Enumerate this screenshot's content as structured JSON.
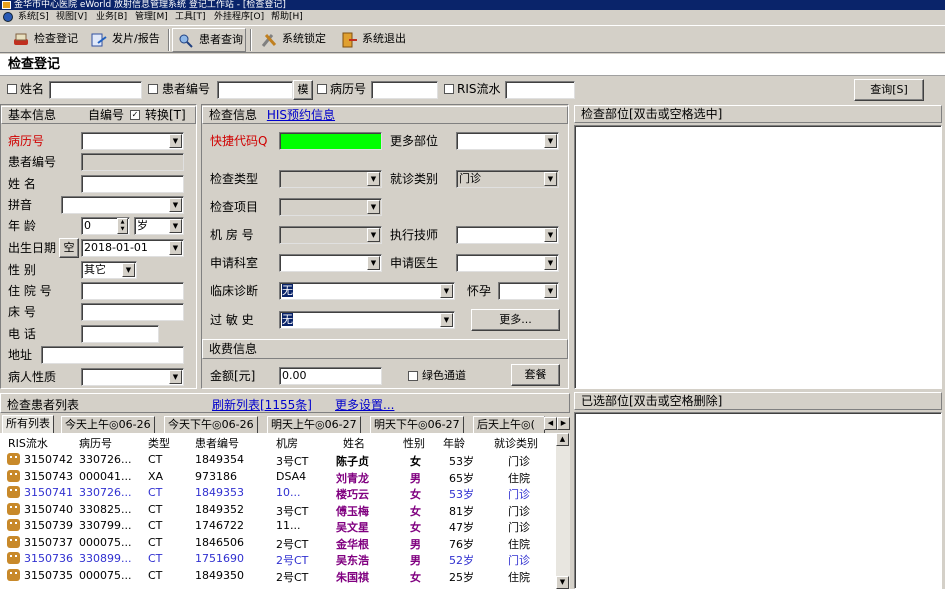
{
  "window": {
    "title": "金华市中心医院 eWorld 放射信息管理系统 登记工作站 - [检查登记]"
  },
  "menu": [
    "系统[S]",
    "视图[V]",
    "业务[B]",
    "管理[M]",
    "工具[T]",
    "外挂程序[O]",
    "帮助[H]"
  ],
  "toolbar": [
    {
      "label": "检查登记",
      "icon": "register-icon"
    },
    {
      "label": "发片/报告",
      "icon": "film-report-icon"
    },
    {
      "label": "患者查询",
      "icon": "patient-query-icon"
    },
    {
      "label": "系统锁定",
      "icon": "lock-tools-icon"
    },
    {
      "label": "系统退出",
      "icon": "exit-icon"
    }
  ],
  "page_title": "检查登记",
  "search": {
    "name_label": "姓名",
    "patient_no_label": "患者编号",
    "fuzzy_button": "模",
    "record_no_label": "病历号",
    "ris_label": "RIS流水",
    "query_button": "查询[S]"
  },
  "basic": {
    "header": "基本信息",
    "auto_no_label": "自编号",
    "convert_label": "转换[T]",
    "record_no": "病历号",
    "patient_no": "患者编号",
    "name": "姓    名",
    "pinyin": "拼音",
    "age": "年    龄",
    "age_value": "0",
    "age_unit": "岁",
    "birth": "出生日期",
    "birth_empty_btn": "空",
    "birth_value": "2018-01-01",
    "sex": "性    别",
    "sex_value": "其它",
    "hosp_no": "住 院 号",
    "bed_no": "床    号",
    "phone": "电    话",
    "address": "地址",
    "nature": "病人性质"
  },
  "exam": {
    "header": "检查信息",
    "his_link": "HIS预约信息",
    "quick_code": "快捷代码Q",
    "more_parts": "更多部位",
    "exam_type": "检查类型",
    "visit_type": "就诊类别",
    "visit_type_value": "门诊",
    "exam_item": "检查项目",
    "room": "机 房 号",
    "tech": "执行技师",
    "dept": "申请科室",
    "doctor": "申请医生",
    "diagnosis": "临床诊断",
    "diagnosis_value": "无",
    "pregnant": "怀孕",
    "allergy": "过 敏 史",
    "allergy_value": "无",
    "more_button": "更多..."
  },
  "fee": {
    "header": "收费信息",
    "amount_label": "金额[元]",
    "amount_value": "0.00",
    "green_label": "绿色通道",
    "package_button": "套餐"
  },
  "parts": {
    "header": "检查部位[双击或空格选中]",
    "selected_header": "已选部位[双击或空格删除]"
  },
  "list": {
    "header": "检查患者列表",
    "refresh_link": "刷新列表[1155条]",
    "settings_link": "更多设置...",
    "tabs": [
      "所有列表",
      "今天上午◎06-26",
      "今天下午◎06-26",
      "明天上午◎06-27",
      "明天下午◎06-27",
      "后天上午◎("
    ],
    "columns": [
      "RIS流水",
      "病历号",
      "类型",
      "患者编号",
      "机房",
      "姓名",
      "性别",
      "年龄",
      "就诊类别"
    ],
    "rows": [
      {
        "ris": "3150742",
        "record": "330726...",
        "type": "CT",
        "pid": "1849354",
        "room": "3号CT",
        "name": "陈子贞",
        "sex": "女",
        "age": "53岁",
        "visit": "门诊",
        "color": "#000000",
        "name_color": "#000000"
      },
      {
        "ris": "3150743",
        "record": "000041...",
        "type": "XA",
        "pid": "973186",
        "room": "DSA4",
        "name": "刘青龙",
        "sex": "男",
        "age": "65岁",
        "visit": "住院",
        "color": "#000000",
        "name_color": "#800080"
      },
      {
        "ris": "3150741",
        "record": "330726...",
        "type": "CT",
        "pid": "1849353",
        "room": "10...",
        "name": "楼巧云",
        "sex": "女",
        "age": "53岁",
        "visit": "门诊",
        "color": "#3030d0",
        "name_color": "#800080"
      },
      {
        "ris": "3150740",
        "record": "330825...",
        "type": "CT",
        "pid": "1849352",
        "room": "3号CT",
        "name": "傅玉梅",
        "sex": "女",
        "age": "81岁",
        "visit": "门诊",
        "color": "#000000",
        "name_color": "#800080"
      },
      {
        "ris": "3150739",
        "record": "330799...",
        "type": "CT",
        "pid": "1746722",
        "room": "11...",
        "name": "吴文星",
        "sex": "女",
        "age": "47岁",
        "visit": "门诊",
        "color": "#000000",
        "name_color": "#800080"
      },
      {
        "ris": "3150737",
        "record": "000075...",
        "type": "CT",
        "pid": "1846506",
        "room": "2号CT",
        "name": "金华根",
        "sex": "男",
        "age": "76岁",
        "visit": "住院",
        "color": "#000000",
        "name_color": "#800080"
      },
      {
        "ris": "3150736",
        "record": "330899...",
        "type": "CT",
        "pid": "1751690",
        "room": "2号CT",
        "name": "吴东浩",
        "sex": "男",
        "age": "52岁",
        "visit": "门诊",
        "color": "#3030d0",
        "name_color": "#800080"
      },
      {
        "ris": "3150735",
        "record": "000075...",
        "type": "CT",
        "pid": "1849350",
        "room": "2号CT",
        "name": "朱国祺",
        "sex": "女",
        "age": "25岁",
        "visit": "住院",
        "color": "#000000",
        "name_color": "#800080"
      }
    ]
  },
  "colors": {
    "quick_code_bg": "#00ff00",
    "title_bar": "#0a246a",
    "link": "#0000cc"
  }
}
